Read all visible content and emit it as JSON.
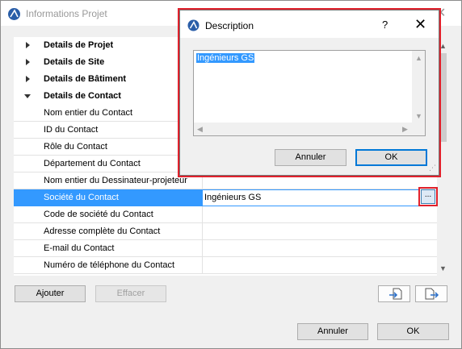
{
  "window": {
    "title": "Informations Projet",
    "close_glyph": "✕"
  },
  "tree": {
    "groups": [
      {
        "label": "Details de Projet",
        "expanded": false
      },
      {
        "label": "Details de Site",
        "expanded": false
      },
      {
        "label": "Details de Bâtiment",
        "expanded": false
      },
      {
        "label": "Details de Contact",
        "expanded": true
      }
    ],
    "items": [
      {
        "label": "Nom entier du Contact",
        "value": ""
      },
      {
        "label": "ID du Contact",
        "value": ""
      },
      {
        "label": "Rôle du Contact",
        "value": ""
      },
      {
        "label": "Département du Contact",
        "value": ""
      },
      {
        "label": "Nom entier du Dessinateur-projeteur",
        "value": ""
      },
      {
        "label": "Société du Contact",
        "value": "Ingénieurs GS",
        "selected": true
      },
      {
        "label": "Code de société du Contact",
        "value": ""
      },
      {
        "label": "Adresse complète du Contact",
        "value": ""
      },
      {
        "label": "E-mail du Contact",
        "value": ""
      },
      {
        "label": "Numéro de téléphone du Contact",
        "value": ""
      }
    ],
    "more_button_label": "..."
  },
  "toolbar": {
    "add_label": "Ajouter",
    "delete_label": "Effacer",
    "import_icon": "import-icon",
    "export_icon": "export-icon"
  },
  "footer": {
    "cancel_label": "Annuler",
    "ok_label": "OK"
  },
  "dialog": {
    "title": "Description",
    "help_glyph": "?",
    "close_glyph": "✕",
    "text": "Ingénieurs GS",
    "cancel_label": "Annuler",
    "ok_label": "OK"
  },
  "colors": {
    "selection": "#3399ff",
    "highlight_border": "#e0212c",
    "default_button": "#0078d7"
  }
}
